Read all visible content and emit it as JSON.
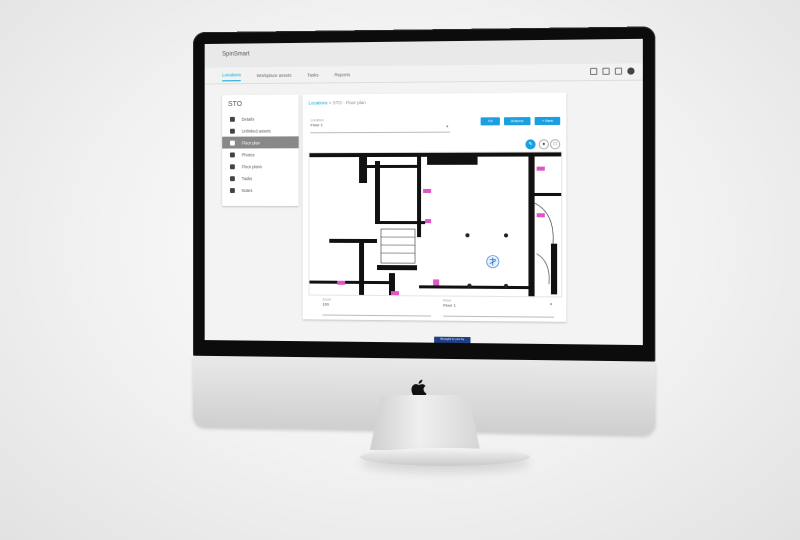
{
  "app": {
    "title": "SpinSmart"
  },
  "tabs": [
    {
      "label": "Locations",
      "active": true
    },
    {
      "label": "Workplace assets",
      "active": false
    },
    {
      "label": "Tasks",
      "active": false
    },
    {
      "label": "Reports",
      "active": false
    }
  ],
  "sidebar": {
    "title": "STO",
    "items": [
      {
        "label": "Details",
        "icon": "list-icon",
        "active": false
      },
      {
        "label": "Unlinked assets",
        "icon": "puzzle-icon",
        "active": false
      },
      {
        "label": "Floor plan",
        "icon": "map-pin-icon",
        "active": true
      },
      {
        "label": "Photos",
        "icon": "image-icon",
        "active": false
      },
      {
        "label": "Floor plans",
        "icon": "layers-icon",
        "active": false
      },
      {
        "label": "Tasks",
        "icon": "clipboard-icon",
        "active": false
      },
      {
        "label": "Notes",
        "icon": "note-icon",
        "active": false
      }
    ]
  },
  "main": {
    "breadcrumb": {
      "root": "Locations",
      "separator": ">",
      "current": "STO - Floor plan"
    },
    "location_select": {
      "label": "Location",
      "value": "Floor 1"
    },
    "buttons": {
      "fit": "Fit",
      "actions": "Actions",
      "new": "+ New"
    },
    "bottom_fields": [
      {
        "label": "Zoom",
        "value": "100"
      },
      {
        "label": "Floor",
        "value": "Floor 1"
      }
    ]
  },
  "badge": {
    "text": "Brought to you by"
  },
  "colors": {
    "accent": "#1a9fe0",
    "marker": "#e056c8",
    "wall": "#111111"
  }
}
